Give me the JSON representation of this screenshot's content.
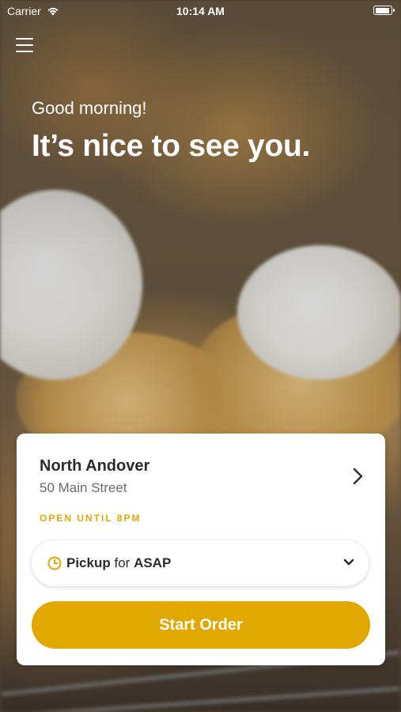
{
  "status_bar": {
    "carrier": "Carrier",
    "time": "10:14 AM"
  },
  "header": {
    "greeting": "Good morning!",
    "headline": "It’s nice to see you."
  },
  "store": {
    "name": "North Andover",
    "address": "50 Main Street",
    "hours": "OPEN UNTIL 8PM"
  },
  "order_mode": {
    "mode": "Pickup",
    "connector": "for",
    "time": "ASAP"
  },
  "actions": {
    "start_order": "Start Order"
  },
  "colors": {
    "accent": "#e0a800",
    "text": "#2b2b2b",
    "muted": "#6b6b6b"
  },
  "icons": [
    "wifi-icon",
    "battery-icon",
    "menu-icon",
    "chevron-right-icon",
    "clock-icon",
    "chevron-down-icon"
  ]
}
